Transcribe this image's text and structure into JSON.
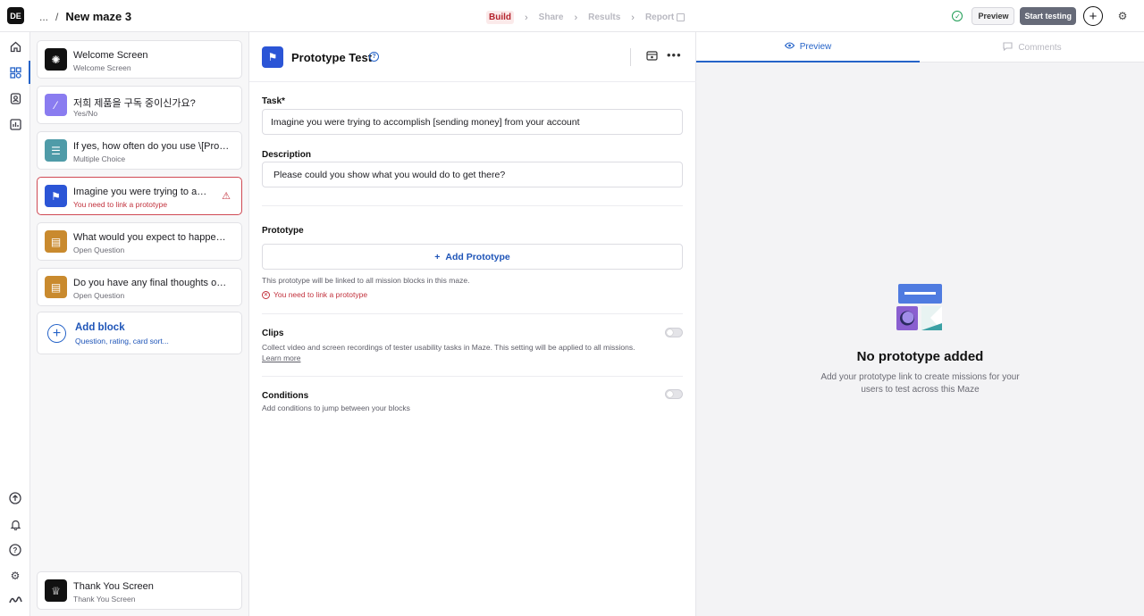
{
  "app": {
    "logo_text": "DE",
    "breadcrumb_ellipsis": "...",
    "breadcrumb_sep": "/",
    "title": "New maze 3"
  },
  "steps": [
    {
      "label": "Build",
      "active": true
    },
    {
      "label": "Share",
      "active": false
    },
    {
      "label": "Results",
      "active": false
    },
    {
      "label": "Report",
      "active": false
    }
  ],
  "header_actions": {
    "preview_label": "Preview",
    "start_label": "Start testing",
    "saved_icon": "check-circle-icon",
    "add_icon": "plus-icon",
    "settings_icon": "gear-icon"
  },
  "rail": {
    "top_icons": [
      "home-icon",
      "blocks-icon",
      "contacts-icon",
      "chart-icon"
    ],
    "bottom_icons": [
      "upgrade-icon",
      "bell-icon",
      "help-icon",
      "settings-icon",
      "maze-logo-icon"
    ],
    "active": "blocks-icon"
  },
  "blocks": [
    {
      "title": "Welcome Screen",
      "subtitle": "Welcome Screen",
      "icon": "sun-icon",
      "color": "#111111",
      "error": false
    },
    {
      "title": "저희 제품을 구독 중이신가요?",
      "subtitle": "Yes/No",
      "icon": "yes-no-icon",
      "color": "#8a7cf0",
      "error": false
    },
    {
      "title": "If yes, how often do you use \\[Product...",
      "subtitle": "Multiple Choice",
      "icon": "list-icon",
      "color": "#4f9ba8",
      "error": false
    },
    {
      "title": "Imagine you were trying to acco...",
      "subtitle": "You need to link a prototype",
      "icon": "flag-icon",
      "color": "#2b55d6",
      "error": true
    },
    {
      "title": "What would you expect to happen on...",
      "subtitle": "Open Question",
      "icon": "chat-icon",
      "color": "#c98a2e",
      "error": false
    },
    {
      "title": "Do you have any final thoughts on wh...",
      "subtitle": "Open Question",
      "icon": "chat-icon",
      "color": "#c98a2e",
      "error": false
    }
  ],
  "add_block": {
    "label": "Add block",
    "hint": "Question, rating, card sort..."
  },
  "thank_you": {
    "title": "Thank You Screen",
    "subtitle": "Thank You Screen",
    "icon": "trophy-icon",
    "color": "#111111"
  },
  "editor": {
    "title": "Prototype Test",
    "task_label": "Task*",
    "task_value": "Imagine you were trying to accomplish [sending money] from your account",
    "description_label": "Description",
    "description_value": "Please could you show what you would do to get there?",
    "prototype_label": "Prototype",
    "add_prototype_label": "Add Prototype",
    "prototype_note": "This prototype will be linked to all mission blocks in this maze.",
    "prototype_error": "You need to link a prototype",
    "clips_label": "Clips",
    "clips_note": "Collect video and screen recordings of tester usability tasks in Maze. This setting will be applied to all missions.",
    "clips_link": "Learn more",
    "clips_enabled": false,
    "conditions_label": "Conditions",
    "conditions_note": "Add conditions to jump between your blocks",
    "conditions_enabled": false
  },
  "preview_pane": {
    "tab_preview": "Preview",
    "tab_comments": "Comments",
    "empty_title": "No prototype added",
    "empty_text": "Add your prototype link to create missions for your users to test across this Maze"
  }
}
